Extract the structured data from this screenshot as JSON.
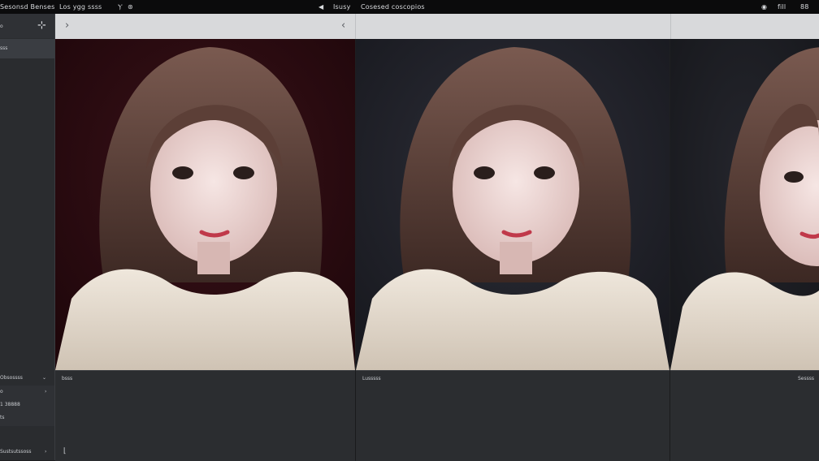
{
  "top_menu": {
    "left_1": "Sesonsd Benses",
    "left_2": "Los ygg ssss",
    "center_1": "Isusy",
    "center_2": "Cosesed coscopios",
    "right_1": "fill",
    "right_2": "88"
  },
  "sidebar": {
    "selected_item": "sss",
    "section_1": "Obsossss",
    "row_1": "o",
    "row_2": "1 38888",
    "row_3": "ts",
    "section_2": "Sustsutssoss",
    "footer_glyph": "E"
  },
  "panels": {
    "panel_1_label": "bsss",
    "panel_2_label": "Lusssss",
    "panel_3_label": "Sessss"
  },
  "colors": {
    "bg_dark": "#1e1f21",
    "toolbar": "#d8d9db",
    "panel1_bg": "#2a0d12",
    "panel2_bg": "#22232c",
    "panel3_bg": "#1c1d22",
    "sweater": "#e6ddd2",
    "hair": "#5a3f36"
  }
}
